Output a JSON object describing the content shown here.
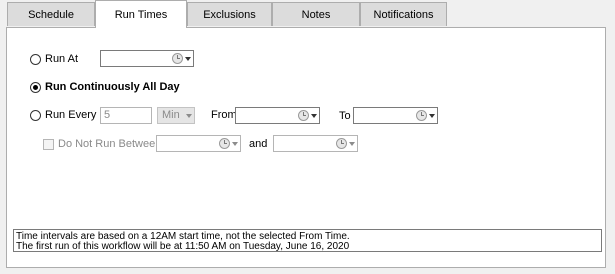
{
  "tabs": [
    {
      "label": "Schedule",
      "active": false
    },
    {
      "label": "Run Times",
      "active": true
    },
    {
      "label": "Exclusions",
      "active": false
    },
    {
      "label": "Notes",
      "active": false
    },
    {
      "label": "Notifications",
      "active": false
    }
  ],
  "run_at": {
    "label": "Run At",
    "selected": false,
    "time_value": ""
  },
  "run_continuously": {
    "label": "Run Continuously All Day",
    "selected": true
  },
  "run_every": {
    "label": "Run Every",
    "selected": false,
    "interval_value": "5",
    "unit_value": "Min",
    "from_label": "From",
    "from_value": "",
    "to_label": "To",
    "to_value": ""
  },
  "do_not_run_between": {
    "label": "Do Not Run Between",
    "checked": false,
    "start_value": "",
    "and_label": "and",
    "end_value": ""
  },
  "info": {
    "line1": "Time intervals are based on a 12AM start time, not the selected From Time.",
    "line2": "The first run of this workflow will be at 11:50 AM on Tuesday, June 16, 2020"
  }
}
